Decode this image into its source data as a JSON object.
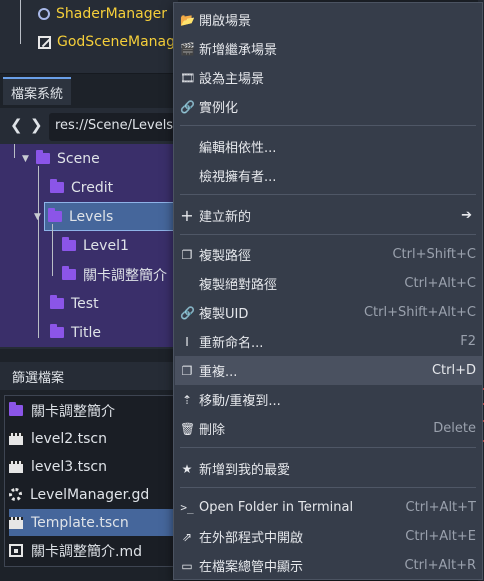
{
  "scene_tree": {
    "items": [
      {
        "label": "ShaderManager",
        "icon": "circle-node-icon"
      },
      {
        "label": "GodSceneManag",
        "icon": "script-node-icon"
      }
    ]
  },
  "filesystem": {
    "tab_label": "檔案系統",
    "path": "res://Scene/Levels",
    "nav_back": "❮",
    "nav_forward": "❯",
    "tree": [
      {
        "label": "Scene"
      },
      {
        "label": "Credit"
      },
      {
        "label": "Levels"
      },
      {
        "label": "Level1"
      },
      {
        "label": "關卡調整簡介"
      },
      {
        "label": "Test"
      },
      {
        "label": "Title"
      }
    ]
  },
  "filter": {
    "header": "篩選檔案",
    "items": [
      {
        "label": "關卡調整簡介",
        "icon": "folder-icon"
      },
      {
        "label": "level2.tscn",
        "icon": "scene-file-icon"
      },
      {
        "label": "level3.tscn",
        "icon": "scene-file-icon"
      },
      {
        "label": "LevelManager.gd",
        "icon": "script-gear-icon"
      },
      {
        "label": "Template.tscn",
        "icon": "scene-file-icon"
      },
      {
        "label": "關卡調整簡介.md",
        "icon": "markdown-file-icon"
      }
    ]
  },
  "context_menu": {
    "items": [
      {
        "label": "開啟場景",
        "icon": "📂",
        "shortcut": ""
      },
      {
        "label": "新增繼承場景",
        "icon": "🎬",
        "shortcut": ""
      },
      {
        "label": "設為主場景",
        "icon": "🎞",
        "shortcut": ""
      },
      {
        "label": "實例化",
        "icon": "🔗",
        "shortcut": ""
      },
      {
        "label": "編輯相依性...",
        "icon": "",
        "shortcut": ""
      },
      {
        "label": "檢視擁有者...",
        "icon": "",
        "shortcut": ""
      },
      {
        "label": "建立新的",
        "icon": "+",
        "shortcut": "",
        "submenu": "➔"
      },
      {
        "label": "複製路徑",
        "icon": "❐",
        "shortcut": "Ctrl+Shift+C"
      },
      {
        "label": "複製絕對路徑",
        "icon": "",
        "shortcut": "Ctrl+Alt+C"
      },
      {
        "label": "複製UID",
        "icon": "🔗",
        "shortcut": "Ctrl+Shift+Alt+C"
      },
      {
        "label": "重新命名...",
        "icon": "I",
        "shortcut": "F2"
      },
      {
        "label": "重複...",
        "icon": "❐",
        "shortcut": "Ctrl+D"
      },
      {
        "label": "移動/重複到...",
        "icon": "⇡",
        "shortcut": ""
      },
      {
        "label": "刪除",
        "icon": "🗑",
        "shortcut": "Delete"
      },
      {
        "label": "新增到我的最愛",
        "icon": "★",
        "shortcut": ""
      },
      {
        "label": "Open Folder in Terminal",
        "icon": ">_",
        "shortcut": "Ctrl+Alt+T"
      },
      {
        "label": "在外部程式中開啟",
        "icon": "⇗",
        "shortcut": "Ctrl+Alt+E"
      },
      {
        "label": "在檔案總管中顯示",
        "icon": "▭",
        "shortcut": "Ctrl+Alt+R"
      }
    ]
  }
}
